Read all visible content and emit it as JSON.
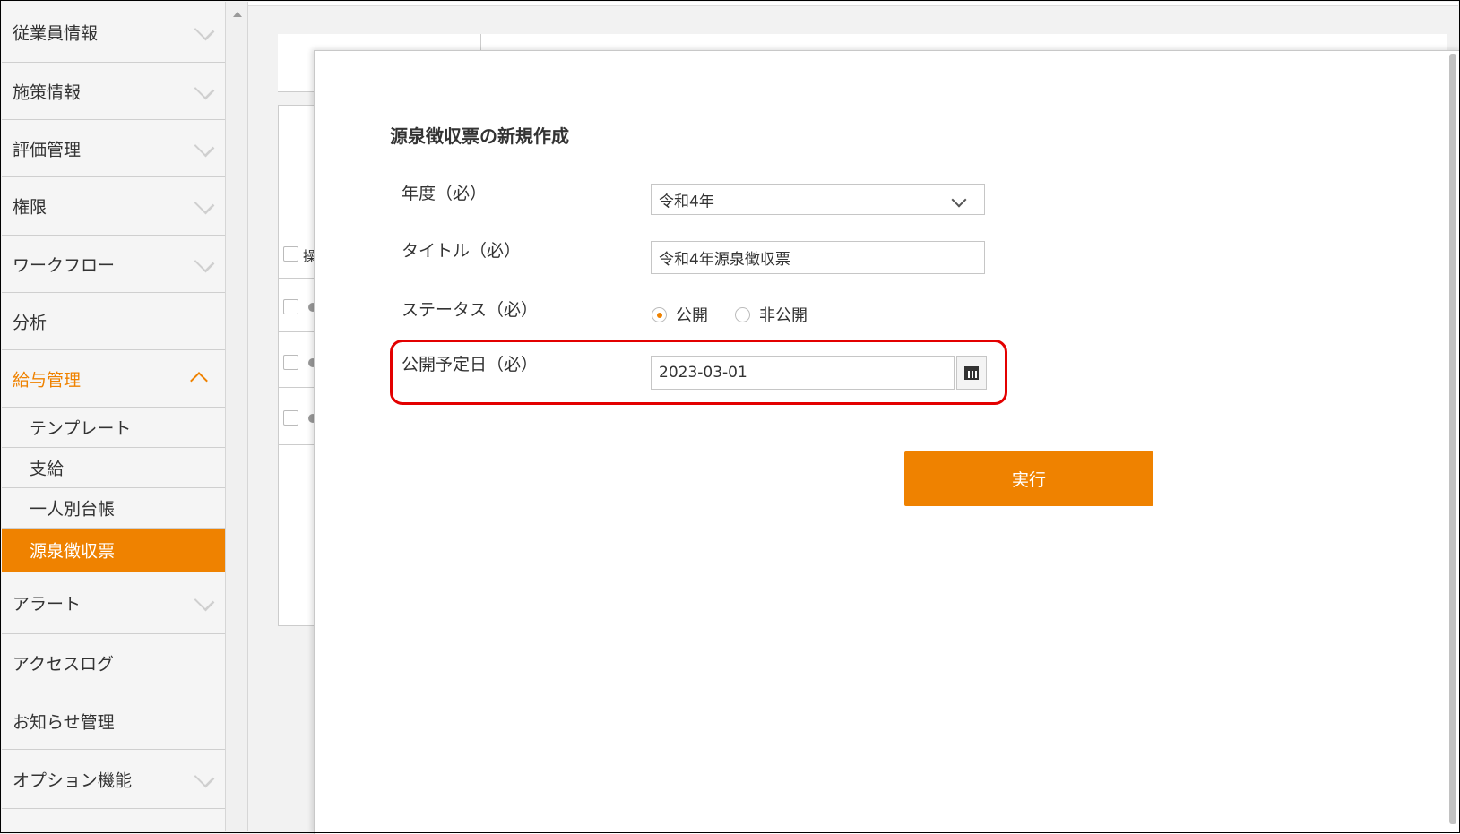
{
  "sidebar": {
    "groups": [
      {
        "label": "従業員情報"
      },
      {
        "label": "施策情報"
      },
      {
        "label": "評価管理"
      },
      {
        "label": "権限"
      },
      {
        "label": "ワークフロー"
      },
      {
        "label": "分析"
      },
      {
        "label": "給与管理"
      },
      {
        "label": "アラート"
      },
      {
        "label": "アクセスログ"
      },
      {
        "label": "お知らせ管理"
      },
      {
        "label": "オプション機能"
      }
    ],
    "payroll_subitems": [
      {
        "label": "テンプレート"
      },
      {
        "label": "支給"
      },
      {
        "label": "一人別台帳"
      },
      {
        "label": "源泉徴収票",
        "selected": true
      }
    ]
  },
  "background": {
    "column_fragment": "操"
  },
  "dialog": {
    "title": "源泉徴収票の新規作成",
    "year": {
      "label": "年度（必）",
      "value": "令和4年"
    },
    "title_field": {
      "label": "タイトル（必）",
      "value": "令和4年源泉徴収票"
    },
    "status": {
      "label": "ステータス（必）",
      "options": [
        {
          "label": "公開",
          "checked": true
        },
        {
          "label": "非公開",
          "checked": false
        }
      ]
    },
    "publish_date": {
      "label": "公開予定日（必）",
      "value": "2023-03-01"
    },
    "submit_label": "実行"
  },
  "colors": {
    "accent": "#ef8200",
    "highlight": "#e30000"
  }
}
